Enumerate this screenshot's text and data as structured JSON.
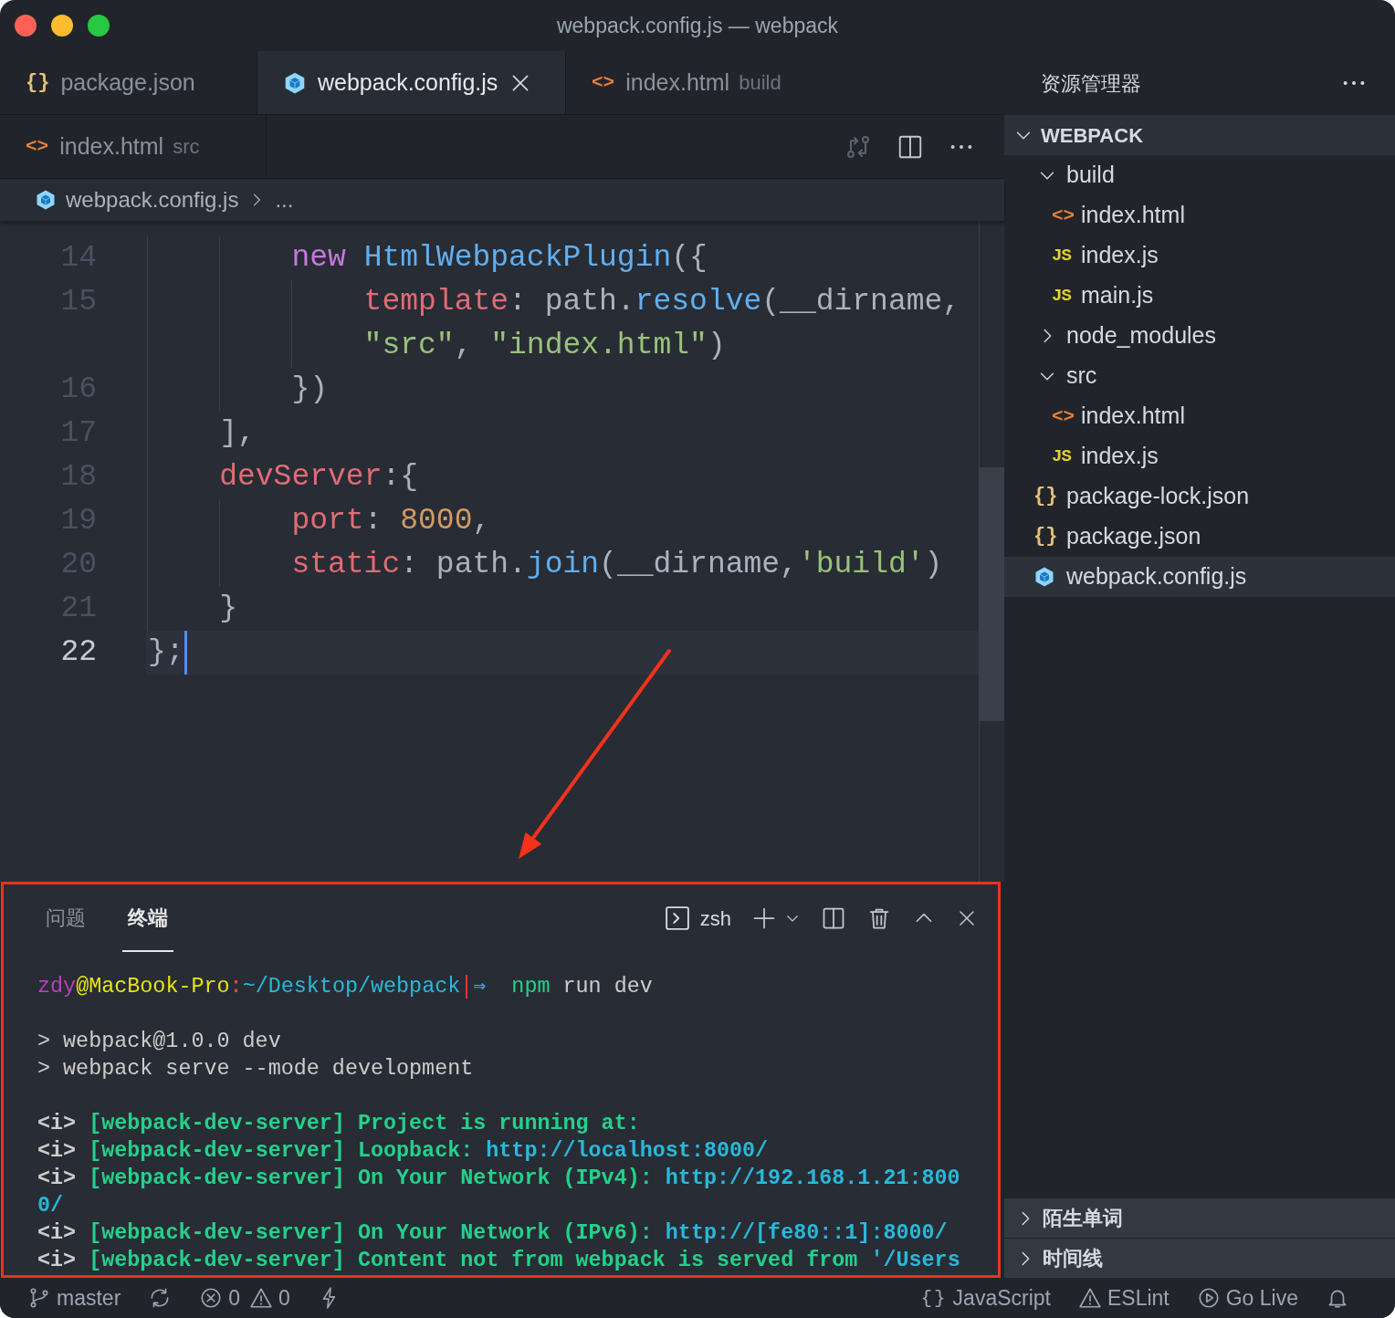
{
  "window": {
    "title": "webpack.config.js — webpack"
  },
  "tab_rows": [
    {
      "tabs": [
        {
          "kind": "json",
          "icon": "{}",
          "label": "package.json",
          "selected": false
        },
        {
          "kind": "webpack",
          "label": "webpack.config.js",
          "selected": true
        },
        {
          "kind": "html",
          "icon": "<>",
          "label": "index.html",
          "description": "build",
          "selected": false
        }
      ]
    },
    {
      "tabs": [
        {
          "kind": "html",
          "icon": "<>",
          "label": "index.html",
          "description": "src",
          "selected": false
        }
      ]
    }
  ],
  "breadcrumb": {
    "kind": "webpack",
    "file": "webpack.config.js",
    "rest": "..."
  },
  "code_lines": [
    {
      "number": "14",
      "current": false,
      "rows": [
        {
          "tokens": [
            {
              "kind": "keyword",
              "text": "        new "
            },
            {
              "kind": "class",
              "text": "HtmlWebpackPlugin"
            },
            {
              "kind": "plain",
              "text": "({"
            }
          ]
        }
      ]
    },
    {
      "number": "15",
      "current": false,
      "rows": [
        {
          "tokens": [
            {
              "kind": "prop",
              "text": "            template"
            },
            {
              "kind": "plain",
              "text": ": path."
            },
            {
              "kind": "func",
              "text": "resolve"
            },
            {
              "kind": "plain",
              "text": "(__dirname,"
            }
          ]
        },
        {
          "tokens": [
            {
              "kind": "string",
              "text": "            \"src\""
            },
            {
              "kind": "plain",
              "text": ", "
            },
            {
              "kind": "string",
              "text": "\"index.html\""
            },
            {
              "kind": "plain",
              "text": ")"
            }
          ]
        }
      ]
    },
    {
      "number": "16",
      "current": false,
      "rows": [
        {
          "tokens": [
            {
              "kind": "plain",
              "text": "        })"
            }
          ]
        }
      ]
    },
    {
      "number": "17",
      "current": false,
      "rows": [
        {
          "tokens": [
            {
              "kind": "plain",
              "text": "    ],"
            }
          ]
        }
      ]
    },
    {
      "number": "18",
      "current": false,
      "rows": [
        {
          "tokens": [
            {
              "kind": "prop",
              "text": "    devServer"
            },
            {
              "kind": "plain",
              "text": ":{"
            }
          ]
        }
      ]
    },
    {
      "number": "19",
      "current": false,
      "rows": [
        {
          "tokens": [
            {
              "kind": "prop",
              "text": "        port"
            },
            {
              "kind": "plain",
              "text": ": "
            },
            {
              "kind": "number",
              "text": "8000"
            },
            {
              "kind": "plain",
              "text": ","
            }
          ]
        }
      ]
    },
    {
      "number": "20",
      "current": false,
      "rows": [
        {
          "tokens": [
            {
              "kind": "prop",
              "text": "        static"
            },
            {
              "kind": "plain",
              "text": ": path."
            },
            {
              "kind": "func",
              "text": "join"
            },
            {
              "kind": "plain",
              "text": "(__dirname,"
            },
            {
              "kind": "string",
              "text": "'build'"
            },
            {
              "kind": "plain",
              "text": ")"
            }
          ]
        }
      ]
    },
    {
      "number": "21",
      "current": false,
      "rows": [
        {
          "tokens": [
            {
              "kind": "plain",
              "text": "    }"
            }
          ]
        }
      ]
    },
    {
      "number": "22",
      "current": true,
      "rows": [
        {
          "tokens": [
            {
              "kind": "plain",
              "text": "};"
            }
          ]
        }
      ]
    }
  ],
  "panel": {
    "highlighted": true,
    "tabs": [
      {
        "label": "问题",
        "selected": false
      },
      {
        "label": "终端",
        "selected": true
      }
    ],
    "shell": "zsh",
    "blocks": [
      {
        "lines": [
          {
            "tokens": [
              {
                "kind": "user",
                "text": "zdy"
              },
              {
                "kind": "host",
                "text": "@MacBook-Pro"
              },
              {
                "kind": "sep",
                "text": ":"
              },
              {
                "kind": "path",
                "text": "~/Desktop/webpack"
              },
              {
                "kind": "arrow",
                "text": "⇒"
              },
              {
                "kind": "command",
                "text": "npm"
              },
              {
                "kind": "plain",
                "text": " run dev"
              }
            ]
          }
        ]
      },
      {
        "lines": [
          {
            "tokens": [
              {
                "kind": "plain",
                "text": "> webpack@1.0.0 dev"
              }
            ]
          },
          {
            "tokens": [
              {
                "kind": "plain",
                "text": "> webpack serve --mode development"
              }
            ]
          }
        ]
      },
      {
        "lines": [
          {
            "tokens": [
              {
                "kind": "info",
                "text": "<i> "
              },
              {
                "kind": "success",
                "text": "[webpack-dev-server] Project is running at:"
              }
            ]
          },
          {
            "tokens": [
              {
                "kind": "info",
                "text": "<i> "
              },
              {
                "kind": "success",
                "text": "[webpack-dev-server] Loopback: "
              },
              {
                "kind": "url",
                "text": "http://localhost:8000/"
              }
            ]
          },
          {
            "tokens": [
              {
                "kind": "info",
                "text": "<i> "
              },
              {
                "kind": "success",
                "text": "[webpack-dev-server] On Your Network (IPv4): "
              },
              {
                "kind": "url",
                "text": "http://192.168.1.21:800"
              }
            ]
          },
          {
            "tokens": [
              {
                "kind": "url",
                "text": "0/"
              }
            ]
          },
          {
            "tokens": [
              {
                "kind": "info",
                "text": "<i> "
              },
              {
                "kind": "success",
                "text": "[webpack-dev-server] On Your Network (IPv6): "
              },
              {
                "kind": "url",
                "text": "http://[fe80::1]:8000/"
              }
            ]
          },
          {
            "tokens": [
              {
                "kind": "info",
                "text": "<i> "
              },
              {
                "kind": "success",
                "text": "[webpack-dev-server] Content not from webpack is served from "
              },
              {
                "kind": "url",
                "text": "'/Users"
              }
            ]
          }
        ]
      }
    ]
  },
  "annotation_arrow": true,
  "explorer": {
    "title": "资源管理器",
    "root": {
      "label": "WEBPACK",
      "expanded": true,
      "children": [
        {
          "kind": "folder",
          "label": "build",
          "expanded": true,
          "selected": false,
          "children": [
            {
              "kind": "html",
              "icon": "<>",
              "label": "index.html",
              "selected": false
            },
            {
              "kind": "js",
              "icon": "JS",
              "label": "index.js",
              "selected": false
            },
            {
              "kind": "js",
              "icon": "JS",
              "label": "main.js",
              "selected": false
            }
          ]
        },
        {
          "kind": "folder",
          "label": "node_modules",
          "expanded": false,
          "selected": false
        },
        {
          "kind": "folder",
          "label": "src",
          "expanded": true,
          "selected": false,
          "children": [
            {
              "kind": "html",
              "icon": "<>",
              "label": "index.html",
              "selected": false
            },
            {
              "kind": "js",
              "icon": "JS",
              "label": "index.js",
              "selected": false
            }
          ]
        },
        {
          "kind": "json",
          "icon": "{}",
          "label": "package-lock.json",
          "selected": false
        },
        {
          "kind": "json",
          "icon": "{}",
          "label": "package.json",
          "selected": false
        },
        {
          "kind": "webpack",
          "label": "webpack.config.js",
          "selected": true
        }
      ]
    },
    "sections": [
      {
        "label": "陌生单词",
        "expanded": false
      },
      {
        "label": "时间线",
        "expanded": false
      }
    ]
  },
  "status_bar": {
    "left": [
      {
        "kind": "branch",
        "text": "master"
      },
      {
        "kind": "sync"
      },
      {
        "kind": "errors",
        "text": "0"
      },
      {
        "kind": "warnings",
        "text": "0"
      },
      {
        "kind": "bolt"
      }
    ],
    "right": [
      {
        "kind": "language",
        "icon": "{}",
        "text": "JavaScript"
      },
      {
        "kind": "eslint",
        "text": "ESLint"
      },
      {
        "kind": "golive",
        "text": "Go Live"
      },
      {
        "kind": "bell"
      }
    ]
  }
}
